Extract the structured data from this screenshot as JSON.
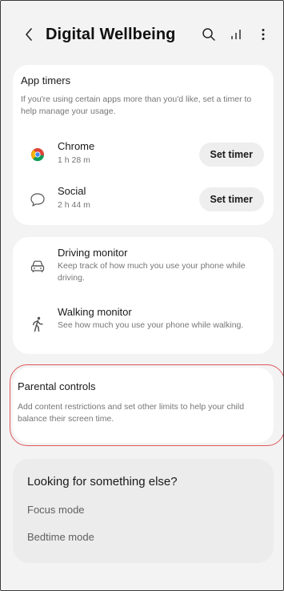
{
  "header": {
    "title": "Digital Wellbeing",
    "back_icon": "chevron-left-icon",
    "search_icon": "search-icon",
    "stats_icon": "signal-bars-icon",
    "more_icon": "more-vert-icon"
  },
  "app_timers": {
    "title": "App timers",
    "description": "If you're using certain apps more than you'd like, set a timer to help manage your usage.",
    "apps": [
      {
        "name": "Chrome",
        "usage": "1 h 28 m",
        "button": "Set timer",
        "icon": "chrome-icon"
      },
      {
        "name": "Social",
        "usage": "2 h 44 m",
        "button": "Set timer",
        "icon": "chat-bubble-icon"
      }
    ]
  },
  "monitors": [
    {
      "title": "Driving monitor",
      "description": "Keep track of how much you use your phone while driving.",
      "icon": "car-icon"
    },
    {
      "title": "Walking monitor",
      "description": "See how much you use your phone while walking.",
      "icon": "walking-icon"
    }
  ],
  "parental": {
    "title": "Parental controls",
    "description": "Add content restrictions and set other limits to help your child balance their screen time."
  },
  "looking": {
    "title": "Looking for something else?",
    "links": [
      "Focus mode",
      "Bedtime mode"
    ]
  },
  "colors": {
    "highlight_outline": "#e0575a",
    "card_bg": "#ffffff",
    "screen_bg": "#f3f3f3"
  }
}
